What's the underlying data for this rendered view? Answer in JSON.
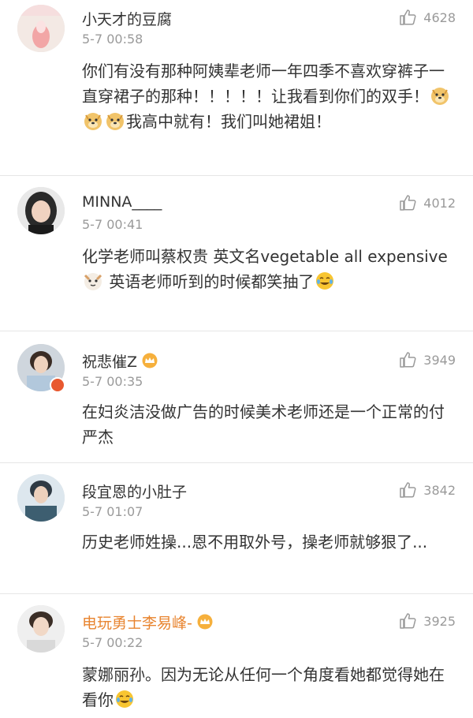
{
  "comments": [
    {
      "username": "小天才的豆腐",
      "time": "5-7 00:58",
      "likes": "4628",
      "text": "你们有没有那种阿姨辈老师一年四季不喜欢穿裤子一直穿裙子的那种！！！！！让我看到你们的双手！",
      "text_after": "我高中就有！我们叫她裙姐！",
      "emoji": "doge-emoji"
    },
    {
      "username": "MINNA____",
      "time": "5-7 00:41",
      "likes": "4012",
      "text": "化学老师叫蔡权贵 英文名vegetable all expensive",
      "text_after": " 英语老师听到的时候都笑抽了",
      "emoji": "cat-emoji"
    },
    {
      "username": "祝悲催Z",
      "time": "5-7 00:35",
      "likes": "3949",
      "text": "在妇炎洁没做广告的时候美术老师还是一个正常的付严杰"
    },
    {
      "username": "段宜恩的小肚子",
      "time": "5-7 01:07",
      "likes": "3842",
      "text": "历史老师姓操...恩不用取外号，操老师就够狠了..."
    },
    {
      "username": "电玩勇士李易峰-",
      "time": "5-7 00:22",
      "likes": "3925",
      "text": "蒙娜丽孙。因为无论从任何一个角度看她都觉得她在看你"
    }
  ],
  "colors": {
    "vip_name": "#e8842f",
    "text": "#333333",
    "meta": "#9a9a9a",
    "divider": "#e6e6e6"
  }
}
